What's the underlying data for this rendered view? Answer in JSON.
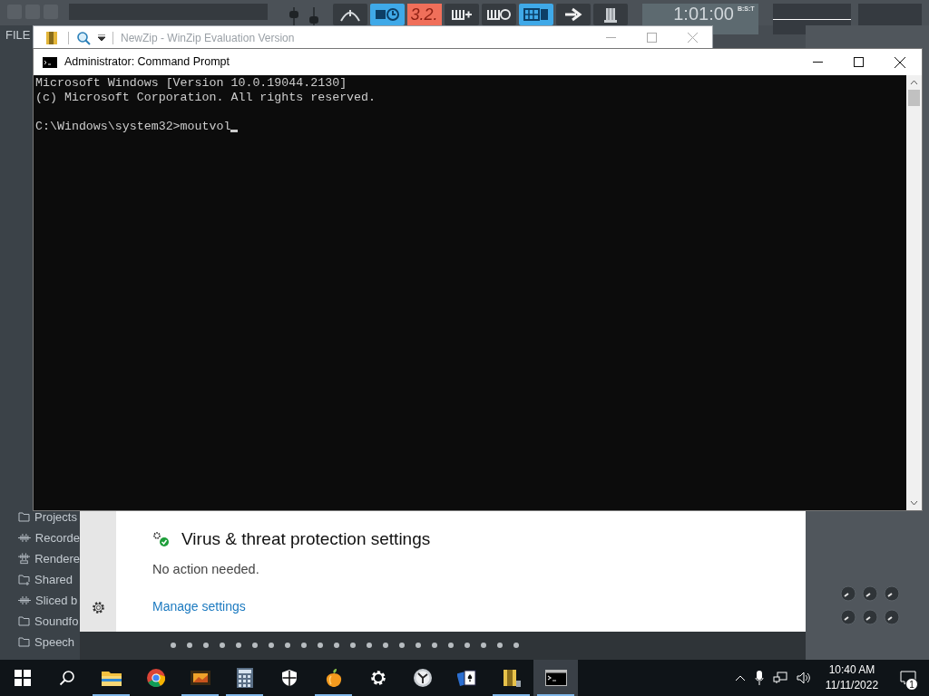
{
  "daw": {
    "menu": "FILE",
    "toolbar": [
      {
        "kind": "arc",
        "on": false
      },
      {
        "kind": "pattern-clock",
        "on": true
      },
      {
        "kind": "display",
        "text": "3.2."
      },
      {
        "kind": "pattern-add",
        "on": false
      },
      {
        "kind": "pattern-loop",
        "on": false
      },
      {
        "kind": "piano",
        "on": true
      },
      {
        "kind": "arrow",
        "on": false
      },
      {
        "kind": "plugin",
        "on": false
      }
    ],
    "time_display": {
      "label": "B:S:T",
      "value": "1:01:00"
    },
    "browser_items": [
      {
        "label": "Projects",
        "kind": "folder"
      },
      {
        "label": "Recorde",
        "kind": "wave"
      },
      {
        "label": "Rendere",
        "kind": "render"
      },
      {
        "label": "Shared",
        "kind": "shared"
      },
      {
        "label": "Sliced b",
        "kind": "wave"
      },
      {
        "label": "Soundfo",
        "kind": "folder"
      },
      {
        "label": "Speech",
        "kind": "folder"
      }
    ]
  },
  "background_window": {
    "title": "NewZip - WinZip Evaluation Version"
  },
  "window": {
    "title": "Administrator: Command Prompt",
    "console_lines": [
      "Microsoft Windows [Version 10.0.19044.2130]",
      "(c) Microsoft Corporation. All rights reserved."
    ],
    "prompt": "C:\\Windows\\system32>moutvol"
  },
  "notification": {
    "title": "Virus & threat protection settings",
    "message": "No action needed.",
    "link": "Manage settings"
  },
  "taskbar": {
    "apps": [
      {
        "kind": "start",
        "running": false,
        "selected": false
      },
      {
        "kind": "search",
        "running": false,
        "selected": false
      },
      {
        "kind": "explorer",
        "running": true,
        "selected": false
      },
      {
        "kind": "chrome",
        "running": false,
        "selected": false
      },
      {
        "kind": "media",
        "running": true,
        "selected": false
      },
      {
        "kind": "calculator",
        "running": true,
        "selected": false
      },
      {
        "kind": "security",
        "running": false,
        "selected": false
      },
      {
        "kind": "daw",
        "running": true,
        "selected": false
      },
      {
        "kind": "settings",
        "running": false,
        "selected": false
      },
      {
        "kind": "clock",
        "running": false,
        "selected": false
      },
      {
        "kind": "cards",
        "running": false,
        "selected": false
      },
      {
        "kind": "archive",
        "running": true,
        "selected": false
      },
      {
        "kind": "terminal",
        "running": true,
        "selected": true
      }
    ],
    "time": "10:40 AM",
    "date": "11/11/2022",
    "notification_count": "1"
  }
}
